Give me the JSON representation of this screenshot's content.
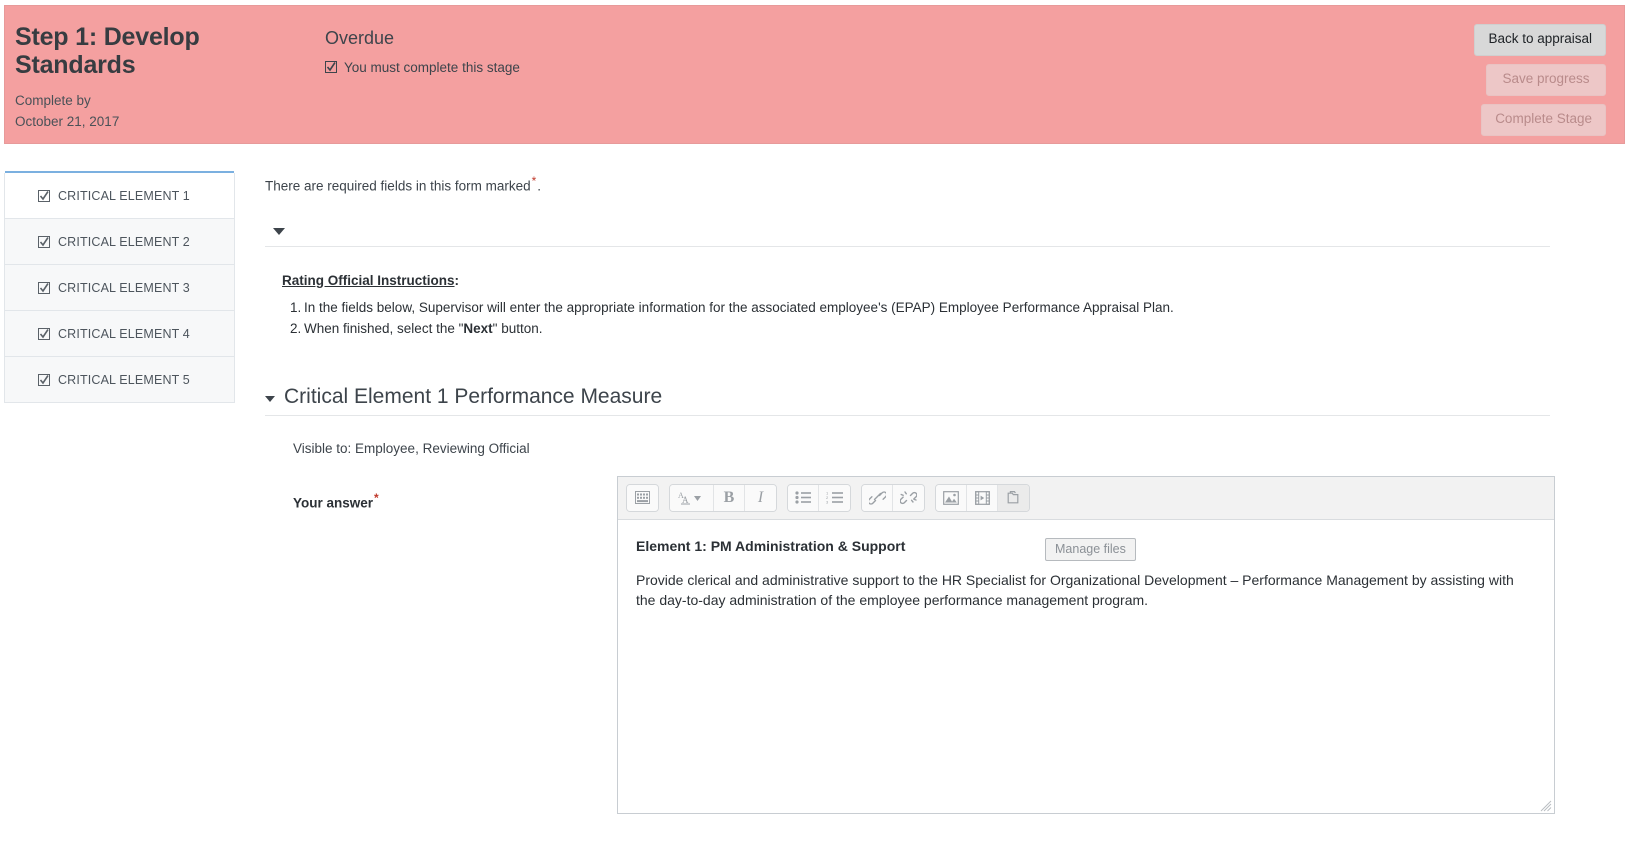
{
  "banner": {
    "stage_title": "Step 1: Develop Standards",
    "complete_by_label": "Complete by",
    "complete_by_date": "October 21, 2017",
    "status": "Overdue",
    "requirement_text": "You must complete this stage",
    "requirement_icon": "checked-checkbox-icon",
    "background_color": "#f4a0a0",
    "buttons": {
      "back": "Back to appraisal",
      "save": "Save progress",
      "complete": "Complete Stage"
    }
  },
  "sidebar": {
    "items": [
      {
        "label": "CRITICAL ELEMENT 1",
        "icon": "checked-checkbox-icon",
        "active": true
      },
      {
        "label": "CRITICAL ELEMENT 2",
        "icon": "checked-checkbox-icon",
        "active": false
      },
      {
        "label": "CRITICAL ELEMENT 3",
        "icon": "checked-checkbox-icon",
        "active": false
      },
      {
        "label": "CRITICAL ELEMENT 4",
        "icon": "checked-checkbox-icon",
        "active": false
      },
      {
        "label": "CRITICAL ELEMENT 5",
        "icon": "checked-checkbox-icon",
        "active": false
      }
    ]
  },
  "main": {
    "required_note_before": "There are required fields in this form marked",
    "required_marker": "*",
    "required_note_after": ".",
    "instructions": {
      "heading": "Rating Official Instructions",
      "heading_colon": ":",
      "items": [
        {
          "num": "1.",
          "text": "In the fields below, Supervisor will enter the appropriate information for the associated employee's (EPAP) Employee Performance Appraisal Plan."
        },
        {
          "num": "2.",
          "text_before": "When finished, select the \"",
          "bold": "Next",
          "text_after": "\" button."
        }
      ]
    },
    "section": {
      "title": "Critical Element 1 Performance Measure",
      "visible_to": "Visible to: Employee, Reviewing Official",
      "answer_label": "Your answer",
      "answer_required_marker": "*"
    },
    "editor": {
      "toolbar": [
        {
          "name": "character-map-icon",
          "group": 0
        },
        {
          "name": "text-style-dropdown-icon",
          "group": 1
        },
        {
          "name": "bold-icon",
          "group": 1,
          "glyph": "B"
        },
        {
          "name": "italic-icon",
          "group": 1,
          "glyph": "I"
        },
        {
          "name": "bulleted-list-icon",
          "group": 2
        },
        {
          "name": "numbered-list-icon",
          "group": 2
        },
        {
          "name": "link-icon",
          "group": 3
        },
        {
          "name": "unlink-icon",
          "group": 3
        },
        {
          "name": "insert-image-icon",
          "group": 4
        },
        {
          "name": "insert-media-icon",
          "group": 4
        },
        {
          "name": "manage-files-icon",
          "group": 4,
          "active": true
        }
      ],
      "content": {
        "title": "Element 1: PM Administration & Support",
        "body": "Provide clerical and administrative support to the HR Specialist for Organizational Development – Performance Management by assisting with the day-to-day administration of the employee performance management program."
      }
    },
    "tooltip": "Manage files"
  }
}
